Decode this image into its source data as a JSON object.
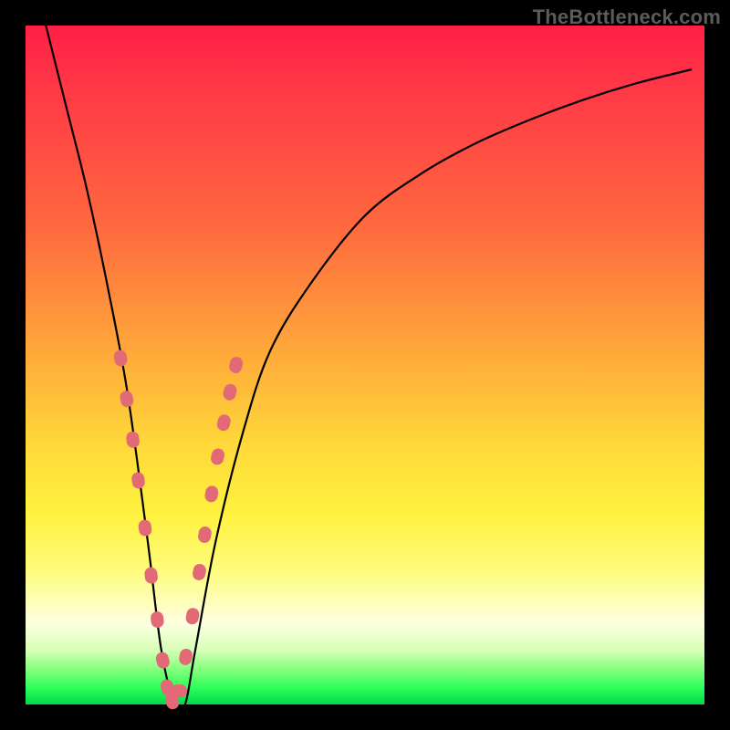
{
  "watermark": "TheBottleneck.com",
  "colors": {
    "marker": "#e26a76",
    "curve": "#000000",
    "frame": "#000000",
    "gradient_top": "#ff1f46",
    "gradient_bottom": "#00d84a"
  },
  "chart_data": {
    "type": "line",
    "title": "",
    "xlabel": "",
    "ylabel": "",
    "xlim": [
      0,
      100
    ],
    "ylim": [
      0,
      100
    ],
    "grid": false,
    "legend": false,
    "series": [
      {
        "name": "bottleneck-curve",
        "x": [
          3,
          6,
          9,
          12,
          15,
          18,
          20,
          22,
          23.5,
          25,
          28,
          32,
          36,
          42,
          50,
          58,
          66,
          74,
          82,
          90,
          98
        ],
        "y": [
          100,
          88,
          76,
          62,
          46,
          24,
          8,
          0,
          0,
          8,
          24,
          40,
          52,
          62,
          72,
          78,
          82.5,
          86,
          89,
          91.5,
          93.5
        ]
      }
    ],
    "markers": {
      "name": "highlighted-points",
      "note": "salmon dots clustered near the V-bottom along both branches",
      "x": [
        14.0,
        14.9,
        15.8,
        16.6,
        17.6,
        18.5,
        19.4,
        20.2,
        20.9,
        21.6,
        22.6,
        23.6,
        24.6,
        25.6,
        26.4,
        27.4,
        28.3,
        29.2,
        30.1,
        31.0
      ],
      "y": [
        51.0,
        45.0,
        39.0,
        33.0,
        26.0,
        19.0,
        12.5,
        6.5,
        2.5,
        0.5,
        2.0,
        7.0,
        13.0,
        19.5,
        25.0,
        31.0,
        36.5,
        41.5,
        46.0,
        50.0
      ]
    }
  }
}
